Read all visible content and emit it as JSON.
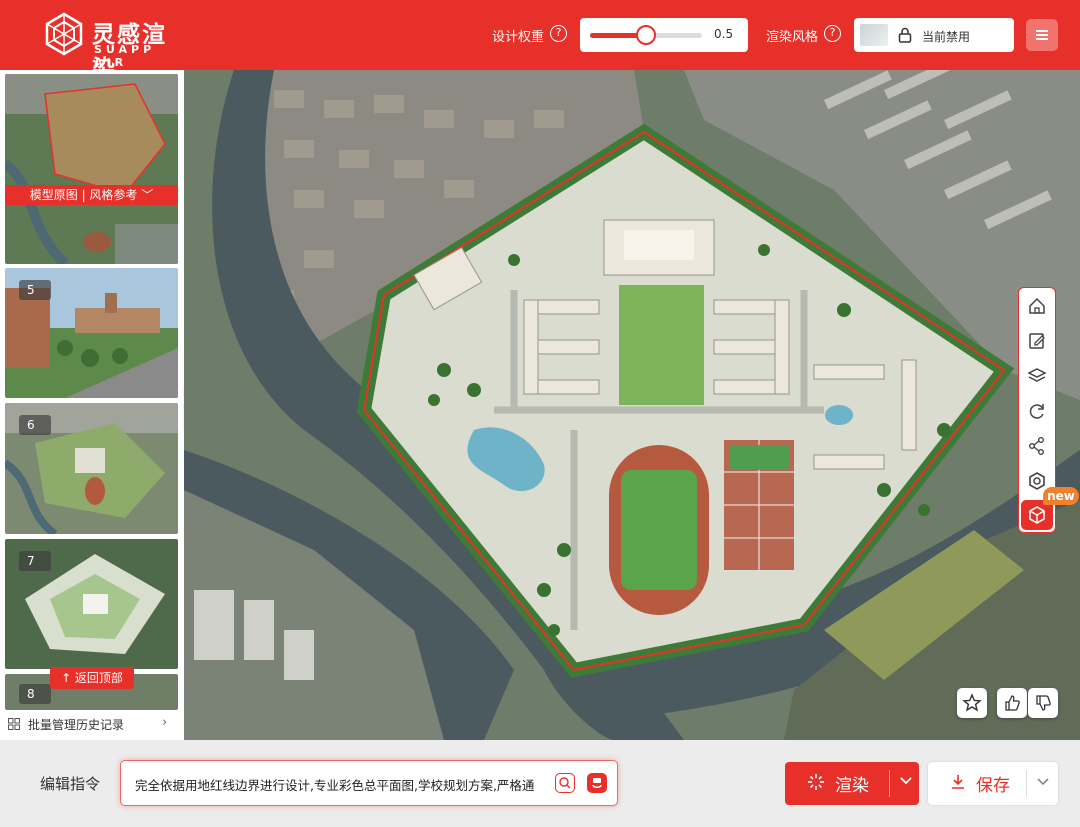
{
  "brand": {
    "name_cn": "灵感渲染",
    "name_en": "SUAPP AIR"
  },
  "header": {
    "design_weight_label": "设计权重",
    "design_weight_value": "0.5",
    "design_weight_fraction": 0.5,
    "render_style_label": "渲染风格",
    "render_style_value": "当前禁用",
    "accent_color": "#e8302a"
  },
  "sidebar": {
    "reference_bar": "模型原图 | 风格参考 ﹀",
    "items": [
      {
        "number": ""
      },
      {
        "number": "5"
      },
      {
        "number": "6"
      },
      {
        "number": "7"
      },
      {
        "number": "8"
      }
    ],
    "back_to_top": "↑ 返回顶部",
    "batch_history": "批量管理历史记录",
    "batch_chevron": "›"
  },
  "toolbar": {
    "tools": [
      "home-icon",
      "edit-icon",
      "layers-icon",
      "refresh-icon",
      "share-icon",
      "settings-icon",
      "render-3d-icon"
    ],
    "new_badge": "new"
  },
  "feedback": [
    "star-icon",
    "thumbs-up-icon",
    "thumbs-down-icon"
  ],
  "bottom": {
    "command_label": "编辑指令",
    "command_text": "完全依据用地红线边界进行设计,专业彩色总平面图,学校规划方案,严格通",
    "render_label": "渲染",
    "save_label": "保存"
  }
}
